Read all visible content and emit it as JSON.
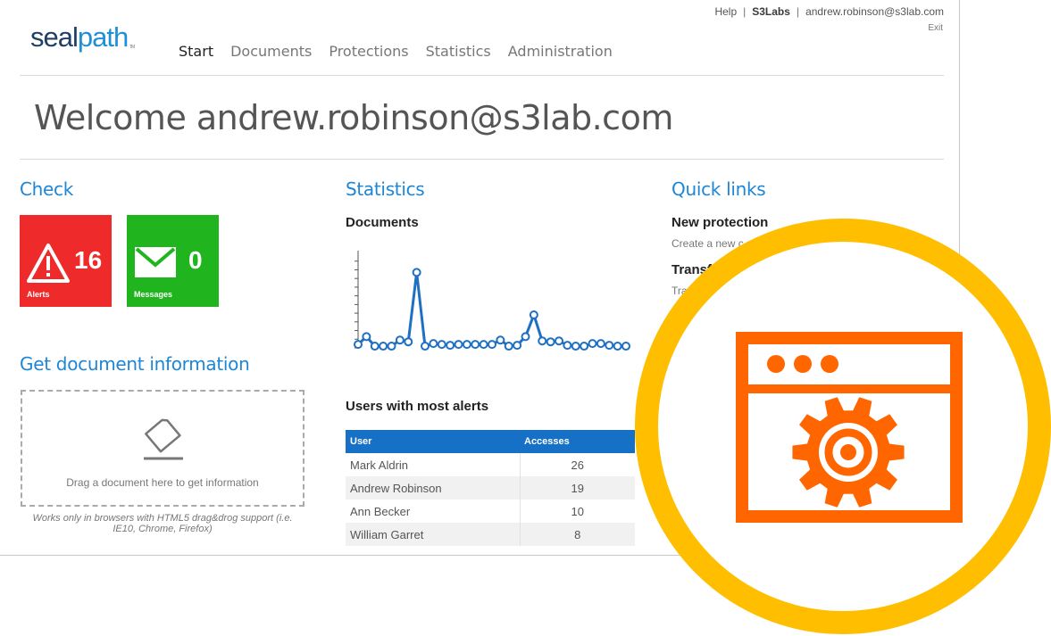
{
  "header": {
    "logo_seal": "seal",
    "logo_path": "path",
    "logo_tm": "TM",
    "help": "Help",
    "organization": "S3Labs",
    "user": "andrew.robinson@s3lab.com",
    "exit": "Exit",
    "separator": "|"
  },
  "nav": [
    {
      "label": "Start",
      "active": true
    },
    {
      "label": "Documents",
      "active": false
    },
    {
      "label": "Protections",
      "active": false
    },
    {
      "label": "Statistics",
      "active": false
    },
    {
      "label": "Administration",
      "active": false
    }
  ],
  "welcome": "Welcome andrew.robinson@s3lab.com",
  "check": {
    "title": "Check",
    "alerts": {
      "count": "16",
      "label": "Alerts",
      "color": "#ee2a2a"
    },
    "messages": {
      "count": "0",
      "label": "Messages",
      "color": "#20b51f"
    }
  },
  "get_doc": {
    "title": "Get document information",
    "drop_text": "Drag a document here to get information",
    "note": "Works only in browsers with HTML5 drag&drog support (i.e. IE10, Chrome, Firefox)"
  },
  "statistics": {
    "title": "Statistics",
    "documents_label": "Documents",
    "users_label": "Users with most alerts",
    "table": {
      "headers": [
        "User",
        "Accesses"
      ],
      "rows": [
        {
          "user": "Mark Aldrin",
          "accesses": "26"
        },
        {
          "user": "Andrew Robinson",
          "accesses": "19"
        },
        {
          "user": "Ann Becker",
          "accesses": "10"
        },
        {
          "user": "William Garret",
          "accesses": "8"
        }
      ]
    }
  },
  "quick_links": {
    "title": "Quick links",
    "items": [
      {
        "title": "New protection",
        "desc": "Create a new c"
      },
      {
        "title": "Transf",
        "desc": "Tra"
      }
    ]
  },
  "chart_data": {
    "type": "line",
    "title": "",
    "xlabel": "",
    "ylabel": "",
    "x": [
      1,
      2,
      3,
      4,
      5,
      6,
      7,
      8,
      9,
      10,
      11,
      12,
      13,
      14,
      15,
      16,
      17,
      18,
      19,
      20,
      21,
      22,
      23,
      24,
      25,
      26,
      27,
      28,
      29,
      30,
      31,
      32,
      33
    ],
    "values": [
      0.4,
      1.3,
      0.2,
      0.2,
      0.2,
      0.9,
      0.7,
      8.7,
      0.2,
      0.5,
      0.4,
      0.3,
      0.4,
      0.4,
      0.4,
      0.4,
      0.4,
      0.9,
      0.2,
      0.3,
      1.3,
      3.8,
      0.8,
      0.7,
      0.8,
      0.3,
      0.2,
      0.2,
      0.5,
      0.5,
      0.3,
      0.2,
      0.2
    ],
    "ylim": [
      0,
      11
    ],
    "color": "#1f6fc3",
    "grid": false
  },
  "overlay": {
    "ring_color": "#ffbe00",
    "icon_color": "#ff6600",
    "icon": "browser-settings-icon"
  }
}
